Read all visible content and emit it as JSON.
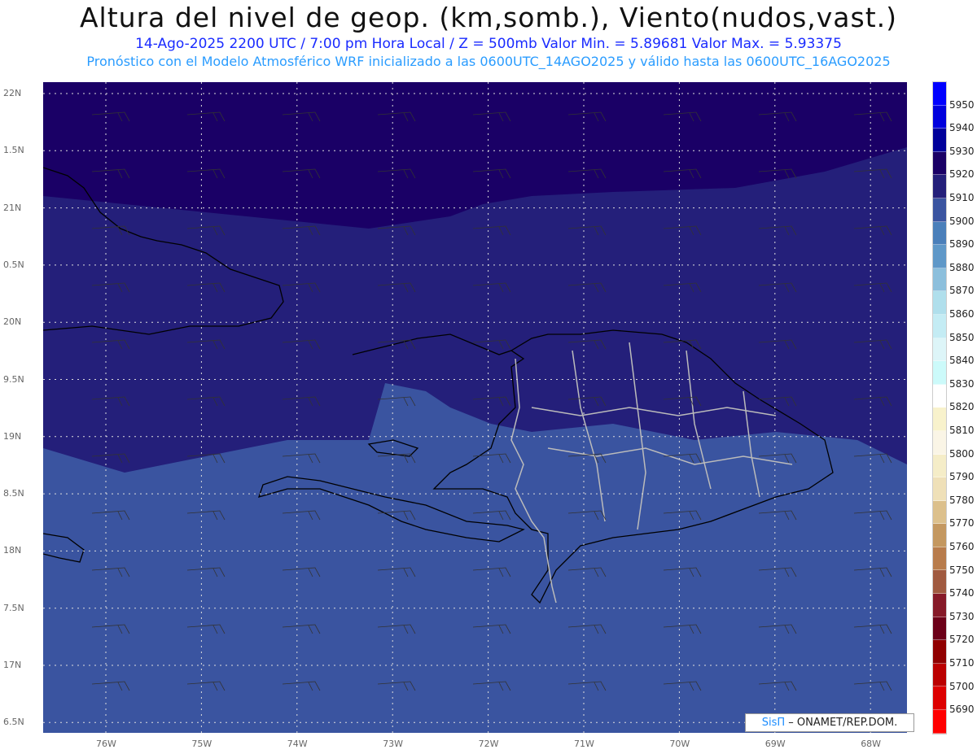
{
  "title": "Altura del nivel de geop. (km,somb.), Viento(nudos,vast.)",
  "subtitle1": "14-Ago-2025  2200 UTC / 7:00 pm Hora Local / Z = 500mb    Valor Min. = 5.89681  Valor Max. = 5.93375",
  "subtitle2": "Pronóstico con el Modelo Atmosférico WRF inicializado a las 0600UTC_14AGO2025 y válido hasta las  0600UTC_16AGO2025",
  "lat_labels": [
    "22N",
    "1.5N",
    "21N",
    "0.5N",
    "20N",
    "9.5N",
    "19N",
    "8.5N",
    "18N",
    "7.5N",
    "17N",
    "6.5N"
  ],
  "lon_labels": [
    "76W",
    "75W",
    "74W",
    "73W",
    "72W",
    "71W",
    "70W",
    "69W",
    "68W"
  ],
  "colorbar": {
    "labels": [
      "5950",
      "5940",
      "5930",
      "5920",
      "5910",
      "5900",
      "5890",
      "5880",
      "5870",
      "5860",
      "5850",
      "5840",
      "5830",
      "5820",
      "5810",
      "5800",
      "5790",
      "5780",
      "5770",
      "5760",
      "5750",
      "5740",
      "5730",
      "5720",
      "5710",
      "5700",
      "5690"
    ],
    "colors": [
      "#0000ff",
      "#0000dd",
      "#00009a",
      "#1a0066",
      "#241f7a",
      "#3a54a0",
      "#4a7fba",
      "#5f98c8",
      "#8cbfdc",
      "#b0dfec",
      "#c4ecf4",
      "#ddf5f8",
      "#ccfafa",
      "#ffffff",
      "#f8f2cc",
      "#faf5e6",
      "#f5edc8",
      "#efe0b8",
      "#dcc08c",
      "#c49860",
      "#b87c4c",
      "#a05a40",
      "#861a28",
      "#6c0018",
      "#900000",
      "#bb0000",
      "#dd0000",
      "#ff0000"
    ]
  },
  "credit": {
    "brand": "SisΠ",
    "text": " – ONAMET/REP.DOM."
  },
  "field_colors": {
    "high": "#1a0066",
    "mid": "#241f7a",
    "low": "#3a54a0"
  }
}
